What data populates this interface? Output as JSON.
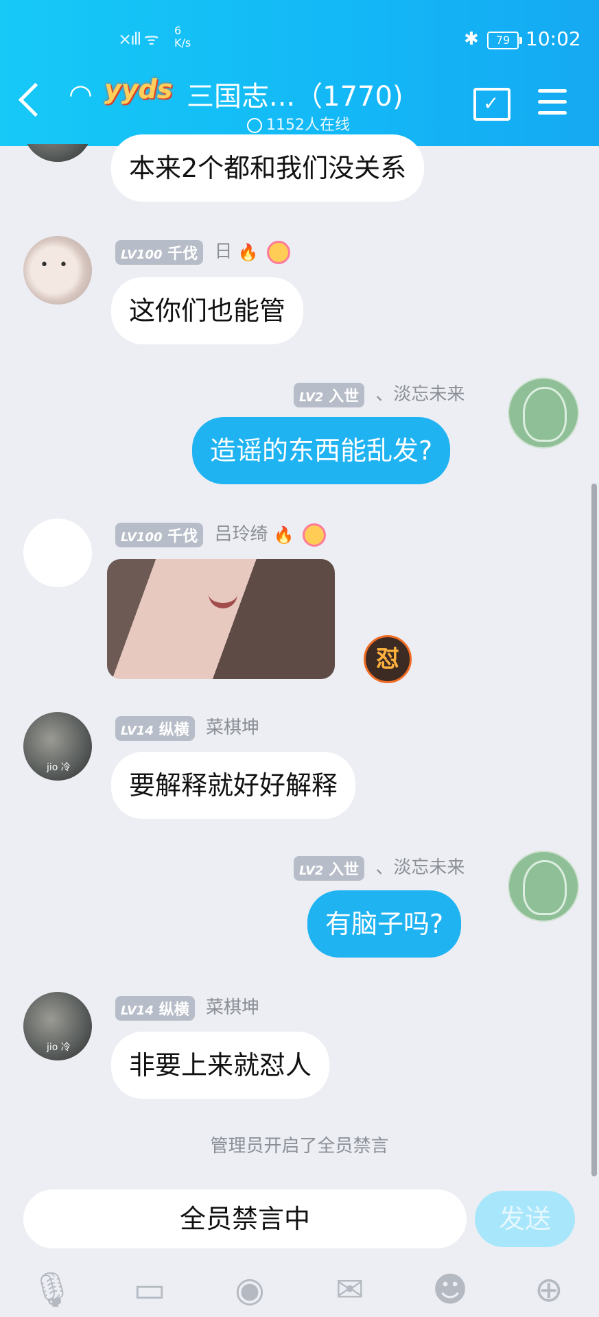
{
  "status_bar": {
    "signal": "⁶",
    "net_speed_value": "6",
    "net_speed_unit": "K/s",
    "battery": "79",
    "time": "10:02"
  },
  "header": {
    "logo_text": "yyds",
    "title": "三国志...（1770)",
    "online": "1152人在线"
  },
  "messages": [
    {
      "type": "in",
      "text": "本来2个都和我们没关系"
    },
    {
      "type": "in",
      "level": "LV100",
      "rank": "千伐",
      "name": "日",
      "text": "这你们也能管"
    },
    {
      "type": "out",
      "level": "LV2",
      "rank": "入世",
      "name": "、淡忘未来",
      "text": "造谣的东西能乱发?"
    },
    {
      "type": "in-image",
      "level": "LV100",
      "rank": "千伐",
      "name": "吕玲绮",
      "badge": "怼"
    },
    {
      "type": "in",
      "level": "LV14",
      "rank": "纵横",
      "name": "菜棋坤",
      "avatar_tag": "jio 冷",
      "text": "要解释就好好解释"
    },
    {
      "type": "out",
      "level": "LV2",
      "rank": "入世",
      "name": "、淡忘未来",
      "text": "有脑子吗?"
    },
    {
      "type": "in",
      "level": "LV14",
      "rank": "纵横",
      "name": "菜棋坤",
      "avatar_tag": "jio 冷",
      "text": "非要上来就怼人"
    }
  ],
  "system_message": "管理员开启了全员禁言",
  "input": {
    "muted_text": "全员禁言中",
    "send_label": "发送"
  },
  "toolbar": [
    "mic-icon",
    "image-icon",
    "camera-icon",
    "red-packet-icon",
    "emoji-icon",
    "plus-icon"
  ],
  "colors": {
    "header": "#13b7f6",
    "bubble_out": "#1fb3f2",
    "background": "#eceef3"
  }
}
